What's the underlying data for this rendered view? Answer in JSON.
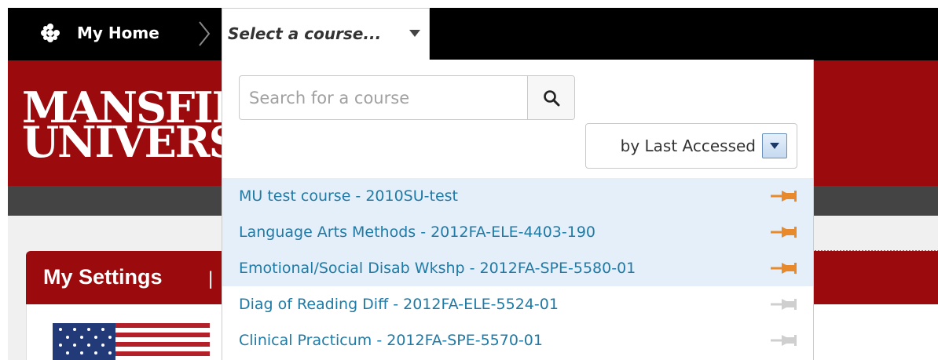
{
  "nav": {
    "home_label": "My Home",
    "selector_label": "Select a course..."
  },
  "banner": {
    "logo_line1": "MANSFIE",
    "logo_line2": "UNIVERSI"
  },
  "settings": {
    "title": "My Settings",
    "separator": "|"
  },
  "dropdown": {
    "search_placeholder": "Search for a course",
    "sort_label": "by Last Accessed",
    "courses": [
      {
        "name": "MU test course - 2010SU-test",
        "pinned": true
      },
      {
        "name": "Language Arts Methods - 2012FA-ELE-4403-190",
        "pinned": true
      },
      {
        "name": "Emotional/Social Disab Wkshp - 2012FA-SPE-5580-01",
        "pinned": true
      },
      {
        "name": "Diag of Reading Diff - 2012FA-ELE-5524-01",
        "pinned": false
      },
      {
        "name": "Clinical Practicum - 2012FA-SPE-5570-01",
        "pinned": false
      }
    ]
  },
  "colors": {
    "topbar": "#000000",
    "brand_red": "#9b0a0d",
    "link_blue": "#1f7aa6",
    "pinned_bg": "#e5eff9",
    "pin_active": "#e8892c",
    "pin_inactive": "#cfcfcf"
  },
  "icons": {
    "home": "flower-home-icon",
    "search": "search-icon",
    "sort_arrow": "chevron-down-icon",
    "pin": "pushpin-icon"
  }
}
